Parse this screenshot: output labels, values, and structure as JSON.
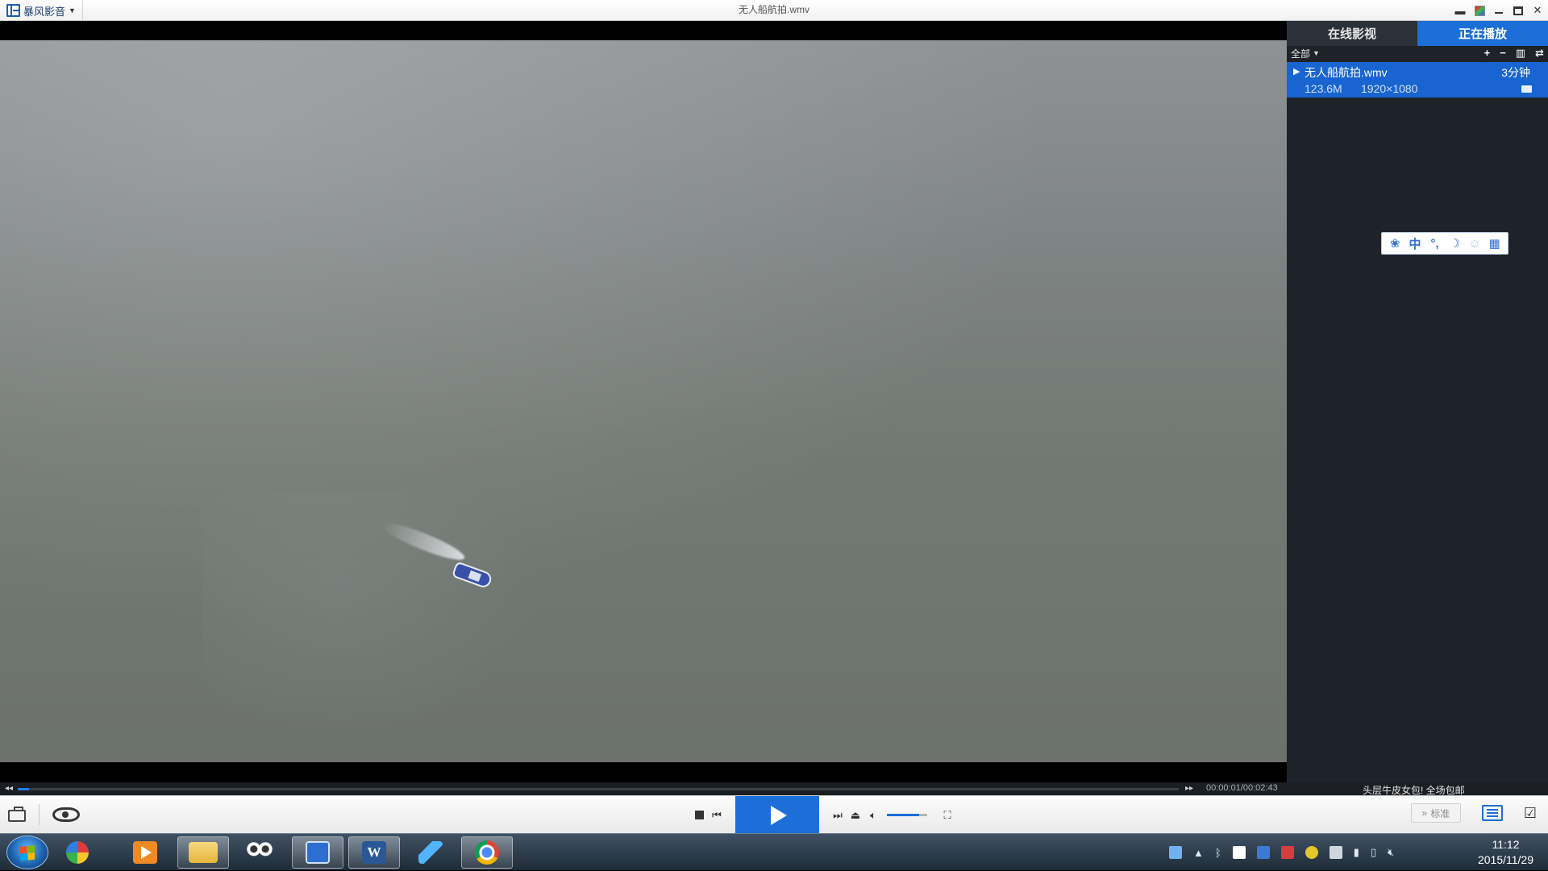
{
  "titlebar": {
    "app_name": "暴风影音",
    "window_title": "无人船航拍.wmv"
  },
  "panel": {
    "tabs": [
      {
        "label": "在线影视",
        "active": false
      },
      {
        "label": "正在播放",
        "active": true
      }
    ],
    "filter_label": "全部",
    "playlist": [
      {
        "name": "无人船航拍.wmv",
        "duration": "3分钟",
        "size": "123.6M",
        "resolution": "1920×1080"
      }
    ],
    "ime_bar": [
      "paw-icon",
      "中",
      "°,",
      "moon-icon",
      "user-icon",
      "grid-icon"
    ],
    "ime_center_label": "中",
    "ime_punct_label": "°,"
  },
  "seek": {
    "time": "00:00:01/00:02:43",
    "progress": 0.006,
    "ad_text": "头层牛皮女包! 全场包邮"
  },
  "controls": {
    "quality_label": "标准",
    "volume_level": 0.8
  },
  "colors": {
    "accent": "#1c6fd8",
    "panel_bg": "#1e2329",
    "playlist_selected": "#1864d0"
  },
  "taskbar": {
    "apps": [
      "start-button",
      "pinwheel-app",
      "video-player-app",
      "file-explorer",
      "movie-maker",
      "storm-player",
      "microsoft-word",
      "bird-app",
      "chrome"
    ],
    "clock_time": "11:12",
    "clock_date": "2015/11/29"
  }
}
